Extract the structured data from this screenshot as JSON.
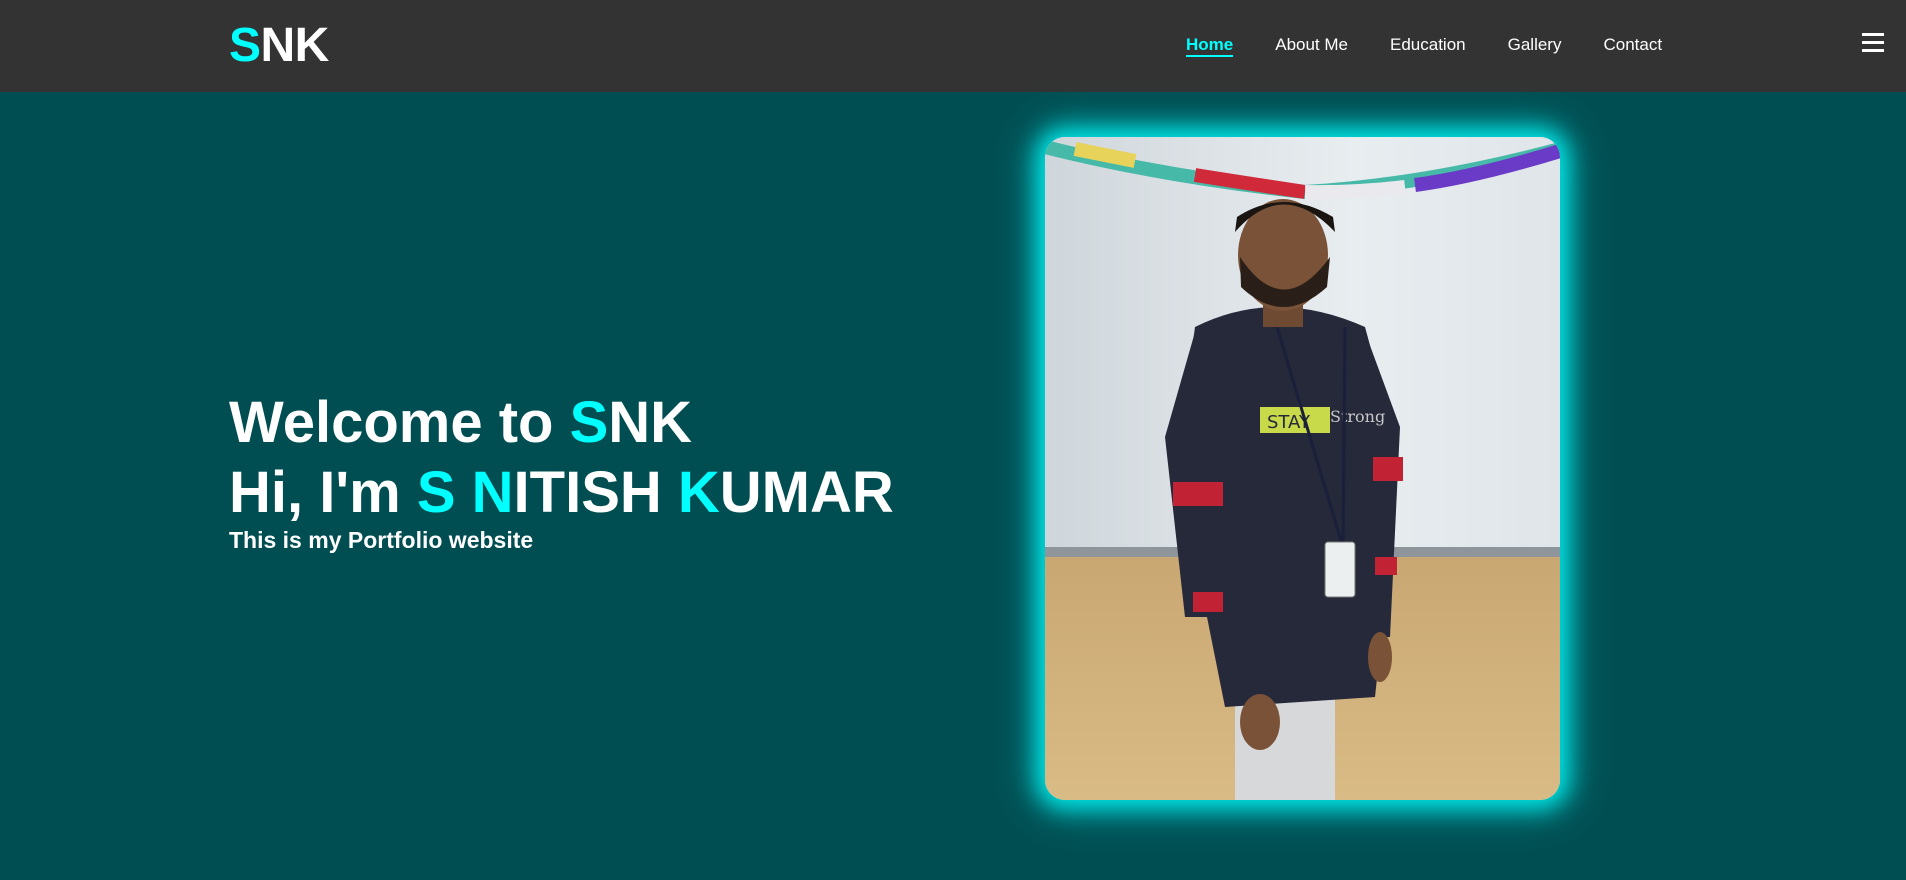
{
  "logo": {
    "first": "S",
    "rest": "NK"
  },
  "nav": {
    "items": [
      {
        "label": "Home",
        "active": true
      },
      {
        "label": "About Me",
        "active": false
      },
      {
        "label": "Education",
        "active": false
      },
      {
        "label": "Gallery",
        "active": false
      },
      {
        "label": "Contact",
        "active": false
      }
    ],
    "menu_icon": "hamburger-icon"
  },
  "hero": {
    "line1": {
      "prefix": "Welcome to ",
      "accent": "S",
      "rest": "NK"
    },
    "line2": {
      "prefix": "Hi, I'm ",
      "s": "S",
      "space": " ",
      "n": "N",
      "itish": "ITISH ",
      "k": "K",
      "umar": "UMAR"
    },
    "subtitle": "This is my Portfolio website"
  },
  "colors": {
    "accent": "#00ffff",
    "navbar": "#333333",
    "background": "#004e52"
  }
}
